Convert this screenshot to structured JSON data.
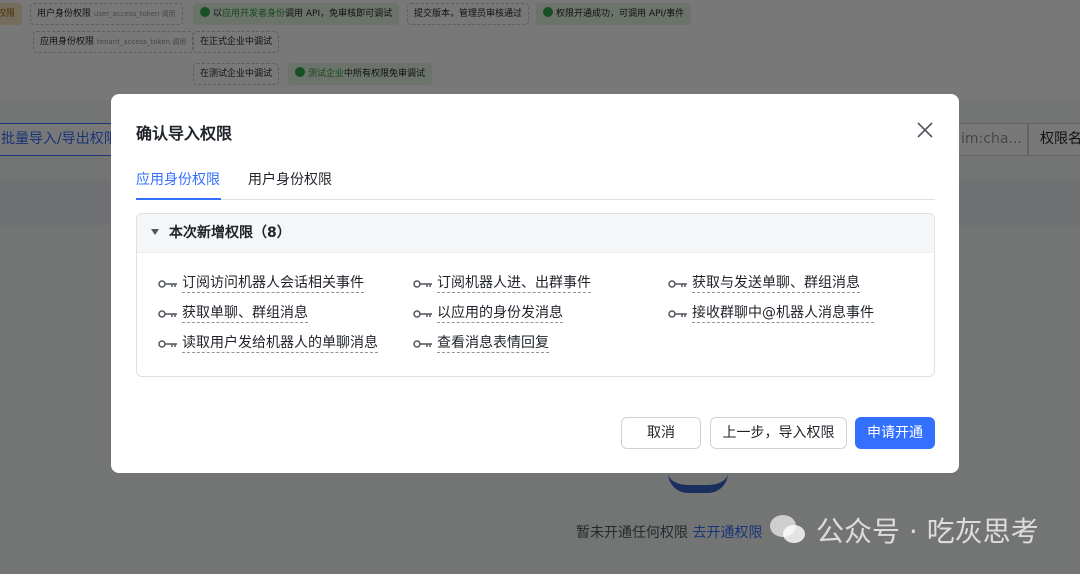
{
  "background": {
    "flow": {
      "start": "权限",
      "user_perm": "用户身份权限",
      "user_token": "user_access_token 调用",
      "dev_debug_pre": "以",
      "dev_debug_hl": "应用开发者身份",
      "dev_debug_post": "调用 API，免审核即可调试",
      "submit": "提交版本，管理员审核通过",
      "success": "权限开通成功，可调用 API/事件",
      "app_perm": "应用身份权限",
      "tenant_token": "tenant_access_token 调用",
      "prod_debug": "在正式企业中调试",
      "test_debug": "在测试企业中调试",
      "test_free_hl": "测试企业",
      "test_free_post": "中所有权限免审调试"
    },
    "toolbar": {
      "batch_button": "批量导入/导出权限",
      "search_placeholder": "im:cha...",
      "filter_label": "权限名"
    },
    "empty": {
      "text": "暂未开通任何权限",
      "link": "去开通权限"
    },
    "watermark": "公众号 · 吃灰思考"
  },
  "modal": {
    "title": "确认导入权限",
    "tabs": [
      {
        "label": "应用身份权限",
        "active": true
      },
      {
        "label": "用户身份权限",
        "active": false
      }
    ],
    "section": {
      "title": "本次新增权限（8）",
      "items": [
        "订阅访问机器人会话相关事件",
        "订阅机器人进、出群事件",
        "获取与发送单聊、群组消息",
        "获取单聊、群组消息",
        "以应用的身份发消息",
        "接收群聊中@机器人消息事件",
        "读取用户发给机器人的单聊消息",
        "查看消息表情回复"
      ]
    },
    "buttons": {
      "cancel": "取消",
      "back": "上一步，导入权限",
      "apply": "申请开通"
    },
    "accent": "#3370ff"
  }
}
